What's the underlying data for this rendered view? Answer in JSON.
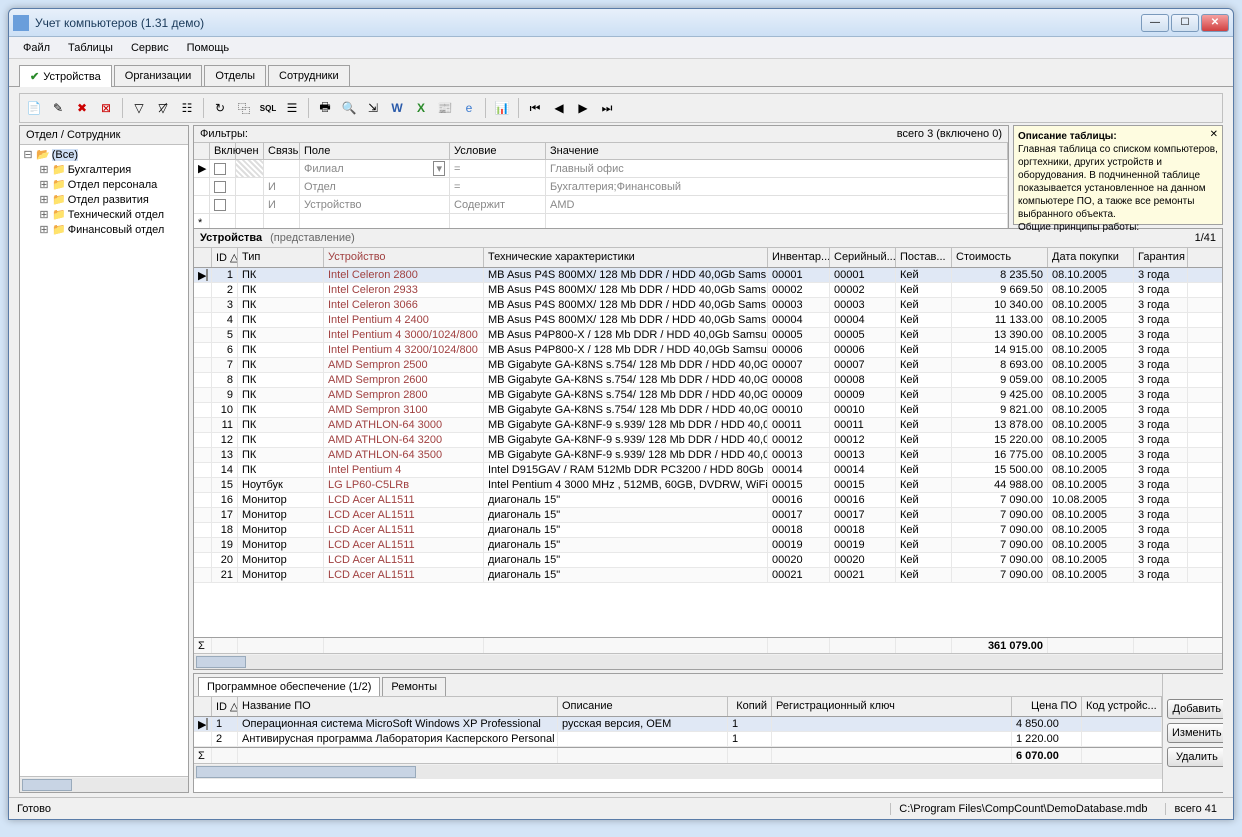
{
  "title": "Учет компьютеров (1.31 демо)",
  "menu": [
    "Файл",
    "Таблицы",
    "Сервис",
    "Помощь"
  ],
  "tabs": [
    "Устройства",
    "Организации",
    "Отделы",
    "Сотрудники"
  ],
  "leftPanel": {
    "header": "Отдел / Сотрудник",
    "root": "(Все)",
    "items": [
      "Бухгалтерия",
      "Отдел персонала",
      "Отдел развития",
      "Технический отдел",
      "Финансовый отдел"
    ]
  },
  "filters": {
    "label": "Фильтры:",
    "count": "всего 3 (включено 0)",
    "columns": [
      "Включен",
      "Связь",
      "Поле",
      "Условие",
      "Значение"
    ],
    "rows": [
      {
        "marker": "▶",
        "link": "",
        "field": "Филиал",
        "cond": "=",
        "value": "Главный офис"
      },
      {
        "marker": "",
        "link": "И",
        "field": "Отдел",
        "cond": "=",
        "value": "Бухгалтерия;Финансовый"
      },
      {
        "marker": "",
        "link": "И",
        "field": "Устройство",
        "cond": "Содержит",
        "value": "AMD"
      },
      {
        "marker": "*",
        "link": "",
        "field": "",
        "cond": "",
        "value": ""
      }
    ]
  },
  "desc": {
    "title": "Описание таблицы:",
    "text": "Главная таблица со списком компьютеров, оргтехники, других устройств и оборудования. В подчиненной таблице показывается установленное на данном компьютере ПО, а также все ремонты выбранного объекта.\nОбщие принципы работы:"
  },
  "grid": {
    "title": "Устройства",
    "subtitle": "(представление)",
    "position": "1/41",
    "columns": [
      "",
      "ID △",
      "Тип",
      "Устройство",
      "Технические характеристики",
      "Инвентар...",
      "Серийный...",
      "Постав...",
      "Стоимость",
      "Дата покупки",
      "Гарантия"
    ],
    "rows": [
      [
        "▶",
        "1",
        "ПК",
        "Intel Celeron 2800",
        "MB Asus P4S 800MX/ 128 Mb DDR / HDD 40,0Gb Sams...",
        "00001",
        "00001",
        "Кей",
        "8 235.50",
        "08.10.2005",
        "3 года"
      ],
      [
        "",
        "2",
        "ПК",
        "Intel Celeron 2933",
        "MB Asus P4S 800MX/ 128 Mb DDR / HDD 40,0Gb Sams...",
        "00002",
        "00002",
        "Кей",
        "9 669.50",
        "08.10.2005",
        "3 года"
      ],
      [
        "",
        "3",
        "ПК",
        "Intel Celeron 3066",
        "MB Asus P4S 800MX/ 128 Mb DDR / HDD 40,0Gb Sams...",
        "00003",
        "00003",
        "Кей",
        "10 340.00",
        "08.10.2005",
        "3 года"
      ],
      [
        "",
        "4",
        "ПК",
        "Intel Pentium 4 2400",
        "MB Asus P4S 800MX/ 128 Mb DDR / HDD 40,0Gb Sams...",
        "00004",
        "00004",
        "Кей",
        "11 133.00",
        "08.10.2005",
        "3 года"
      ],
      [
        "",
        "5",
        "ПК",
        "Intel Pentium 4 3000/1024/800",
        "MB Asus P4P800-X / 128 Mb DDR / HDD 40,0Gb Samsur",
        "00005",
        "00005",
        "Кей",
        "13 390.00",
        "08.10.2005",
        "3 года"
      ],
      [
        "",
        "6",
        "ПК",
        "Intel Pentium 4 3200/1024/800",
        "MB Asus P4P800-X / 128 Mb DDR / HDD 40,0Gb Samsur",
        "00006",
        "00006",
        "Кей",
        "14 915.00",
        "08.10.2005",
        "3 года"
      ],
      [
        "",
        "7",
        "ПК",
        "AMD Sempron 2500",
        "MB Gigabyte GA-K8NS s.754/ 128 Mb DDR / HDD 40,0G",
        "00007",
        "00007",
        "Кей",
        "8 693.00",
        "08.10.2005",
        "3 года"
      ],
      [
        "",
        "8",
        "ПК",
        "AMD Sempron 2600",
        "MB Gigabyte GA-K8NS s.754/ 128 Mb DDR / HDD 40,0G",
        "00008",
        "00008",
        "Кей",
        "9 059.00",
        "08.10.2005",
        "3 года"
      ],
      [
        "",
        "9",
        "ПК",
        "AMD Sempron 2800",
        "MB Gigabyte GA-K8NS s.754/ 128 Mb DDR / HDD 40,0G",
        "00009",
        "00009",
        "Кей",
        "9 425.00",
        "08.10.2005",
        "3 года"
      ],
      [
        "",
        "10",
        "ПК",
        "AMD Sempron 3100",
        "MB Gigabyte GA-K8NS s.754/ 128 Mb DDR / HDD 40,0G",
        "00010",
        "00010",
        "Кей",
        "9 821.00",
        "08.10.2005",
        "3 года"
      ],
      [
        "",
        "11",
        "ПК",
        "AMD ATHLON-64 3000",
        "MB Gigabyte GA-K8NF-9 s.939/ 128 Mb DDR / HDD 40,0",
        "00011",
        "00011",
        "Кей",
        "13 878.00",
        "08.10.2005",
        "3 года"
      ],
      [
        "",
        "12",
        "ПК",
        "AMD ATHLON-64 3200",
        "MB Gigabyte GA-K8NF-9 s.939/ 128 Mb DDR / HDD 40,0",
        "00012",
        "00012",
        "Кей",
        "15 220.00",
        "08.10.2005",
        "3 года"
      ],
      [
        "",
        "13",
        "ПК",
        "AMD ATHLON-64 3500",
        "MB Gigabyte GA-K8NF-9 s.939/ 128 Mb DDR / HDD 40,0",
        "00013",
        "00013",
        "Кей",
        "16 775.00",
        "08.10.2005",
        "3 года"
      ],
      [
        "",
        "14",
        "ПК",
        "Intel Pentium 4",
        "Intel D915GAV / RAM 512Mb DDR PC3200 / HDD 80Gb",
        "00014",
        "00014",
        "Кей",
        "15 500.00",
        "08.10.2005",
        "3 года"
      ],
      [
        "",
        "15",
        "Ноутбук",
        "LG LP60-C5LRв",
        "Intel Pentium 4 3000 MHz , 512MB, 60GB, DVDRW, WiFi,",
        "00015",
        "00015",
        "Кей",
        "44 988.00",
        "08.10.2005",
        "3 года"
      ],
      [
        "",
        "16",
        "Монитор",
        "LCD Acer AL1511",
        "диагональ 15\"",
        "00016",
        "00016",
        "Кей",
        "7 090.00",
        "10.08.2005",
        "3 года"
      ],
      [
        "",
        "17",
        "Монитор",
        "LCD Acer AL1511",
        "диагональ 15\"",
        "00017",
        "00017",
        "Кей",
        "7 090.00",
        "08.10.2005",
        "3 года"
      ],
      [
        "",
        "18",
        "Монитор",
        "LCD Acer AL1511",
        "диагональ 15\"",
        "00018",
        "00018",
        "Кей",
        "7 090.00",
        "08.10.2005",
        "3 года"
      ],
      [
        "",
        "19",
        "Монитор",
        "LCD Acer AL1511",
        "диагональ 15\"",
        "00019",
        "00019",
        "Кей",
        "7 090.00",
        "08.10.2005",
        "3 года"
      ],
      [
        "",
        "20",
        "Монитор",
        "LCD Acer AL1511",
        "диагональ 15\"",
        "00020",
        "00020",
        "Кей",
        "7 090.00",
        "08.10.2005",
        "3 года"
      ],
      [
        "",
        "21",
        "Монитор",
        "LCD Acer AL1511",
        "диагональ 15\"",
        "00021",
        "00021",
        "Кей",
        "7 090.00",
        "08.10.2005",
        "3 года"
      ]
    ],
    "sumLabel": "Σ",
    "sum": "361 079.00"
  },
  "soft": {
    "tabs": [
      "Программное обеспечение (1/2)",
      "Ремонты"
    ],
    "columns": [
      "",
      "ID △",
      "Название ПО",
      "Описание",
      "Копий",
      "Регистрационный ключ",
      "Цена ПО",
      "Код устройс..."
    ],
    "rows": [
      [
        "▶",
        "1",
        "Операционная система MicroSoft Windows XP Professional",
        "русская версия, OEM",
        "1",
        "",
        "4 850.00",
        ""
      ],
      [
        "",
        "2",
        "Антивирусная программа Лаборатория Касперского Personal",
        "",
        "1",
        "",
        "1 220.00",
        ""
      ]
    ],
    "sum": "6 070.00"
  },
  "buttons": {
    "add": "Добавить",
    "edit": "Изменить",
    "del": "Удалить"
  },
  "status": {
    "ready": "Готово",
    "path": "C:\\Program Files\\CompCount\\DemoDatabase.mdb",
    "total": "всего 41"
  }
}
